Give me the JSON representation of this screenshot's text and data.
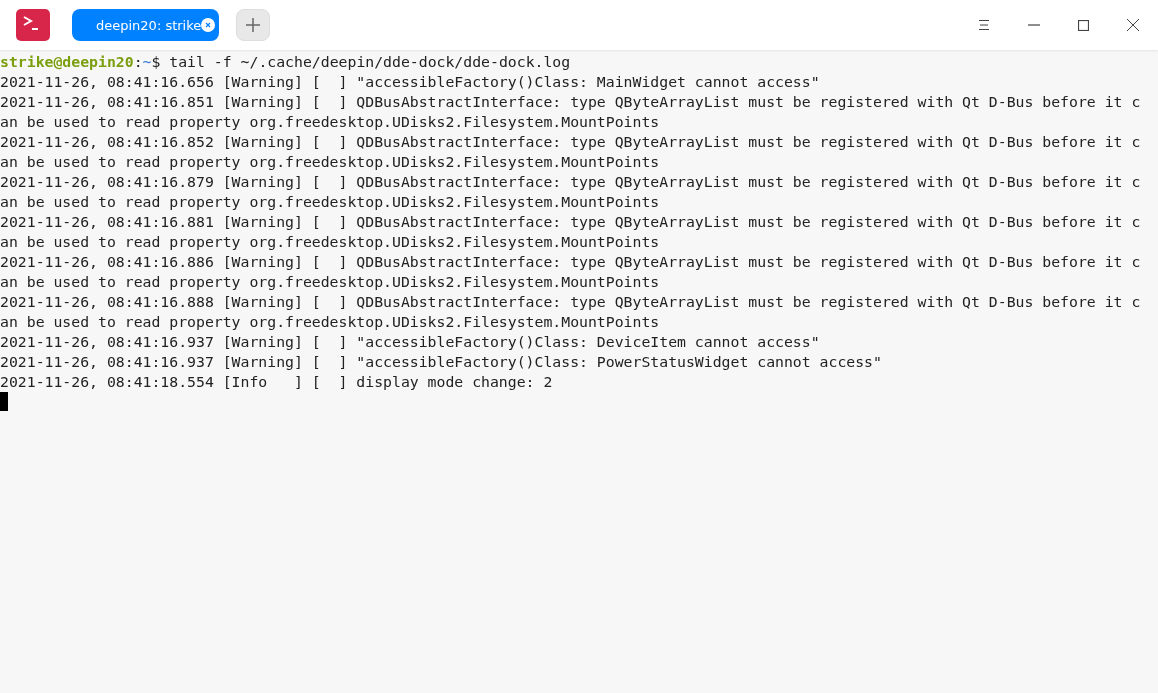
{
  "tabs": [
    {
      "label": "deepin20: strike",
      "selected": true
    }
  ],
  "prompt": {
    "user_host": "strike@deepin20",
    "separator": ":",
    "path": "~",
    "command": "$ tail -f ~/.cache/deepin/dde-dock/dde-dock.log"
  },
  "output_lines": [
    "2021-11-26, 08:41:16.656 [Warning] [  ] \"accessibleFactory()Class: MainWidget cannot access\"",
    "2021-11-26, 08:41:16.851 [Warning] [  ] QDBusAbstractInterface: type QByteArrayList must be registered with Qt D-Bus before it c",
    "an be used to read property org.freedesktop.UDisks2.Filesystem.MountPoints",
    "2021-11-26, 08:41:16.852 [Warning] [  ] QDBusAbstractInterface: type QByteArrayList must be registered with Qt D-Bus before it c",
    "an be used to read property org.freedesktop.UDisks2.Filesystem.MountPoints",
    "2021-11-26, 08:41:16.879 [Warning] [  ] QDBusAbstractInterface: type QByteArrayList must be registered with Qt D-Bus before it c",
    "an be used to read property org.freedesktop.UDisks2.Filesystem.MountPoints",
    "2021-11-26, 08:41:16.881 [Warning] [  ] QDBusAbstractInterface: type QByteArrayList must be registered with Qt D-Bus before it c",
    "an be used to read property org.freedesktop.UDisks2.Filesystem.MountPoints",
    "2021-11-26, 08:41:16.886 [Warning] [  ] QDBusAbstractInterface: type QByteArrayList must be registered with Qt D-Bus before it c",
    "an be used to read property org.freedesktop.UDisks2.Filesystem.MountPoints",
    "2021-11-26, 08:41:16.888 [Warning] [  ] QDBusAbstractInterface: type QByteArrayList must be registered with Qt D-Bus before it c",
    "an be used to read property org.freedesktop.UDisks2.Filesystem.MountPoints",
    "2021-11-26, 08:41:16.937 [Warning] [  ] \"accessibleFactory()Class: DeviceItem cannot access\"",
    "2021-11-26, 08:41:16.937 [Warning] [  ] \"accessibleFactory()Class: PowerStatusWidget cannot access\"",
    "2021-11-26, 08:41:18.554 [Info   ] [  ] display mode change: 2"
  ]
}
